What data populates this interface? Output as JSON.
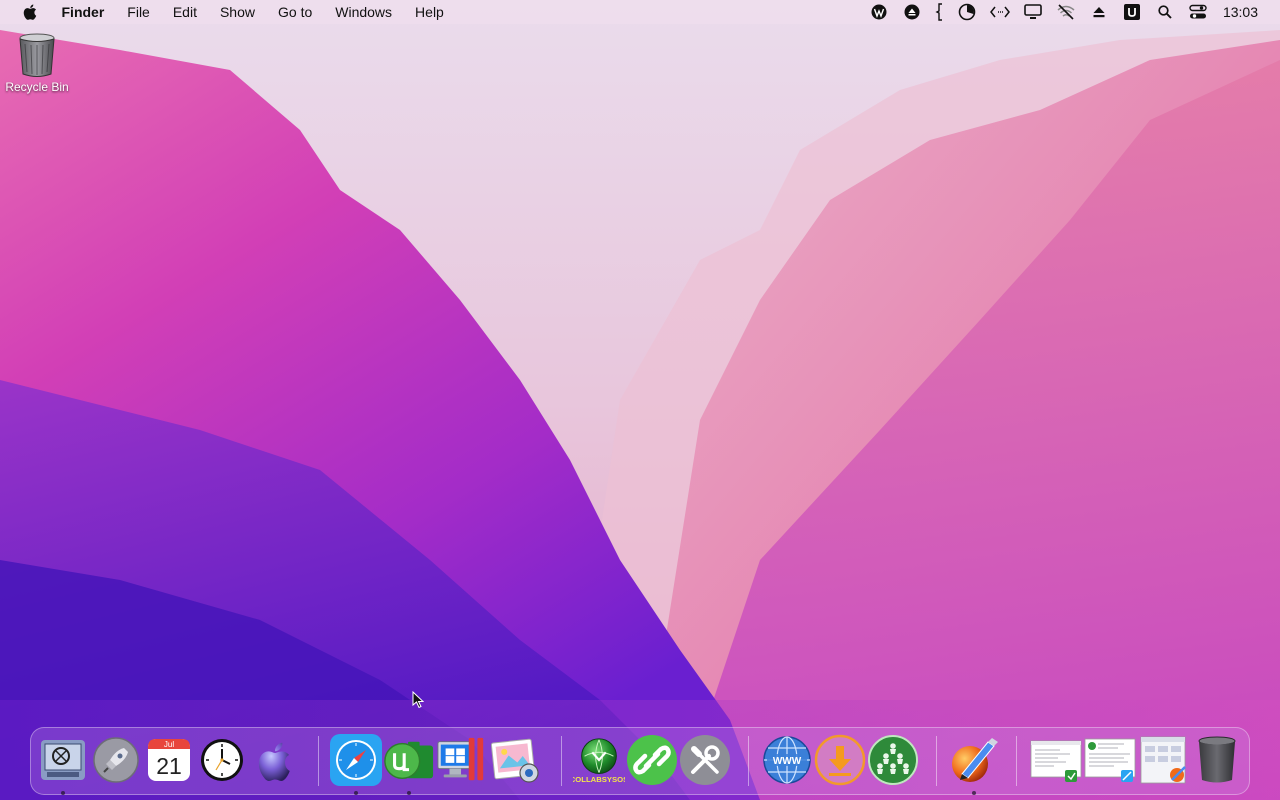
{
  "menubar": {
    "apple_icon": "apple-logo-icon",
    "items": [
      {
        "label": "Finder",
        "app": true
      },
      {
        "label": "File"
      },
      {
        "label": "Edit"
      },
      {
        "label": "Show"
      },
      {
        "label": "Go to"
      },
      {
        "label": "Windows"
      },
      {
        "label": "Help"
      }
    ],
    "tray_icons": [
      "wordpress-icon",
      "eject-circle-icon",
      "bracket-icon",
      "pie-timer-icon",
      "code-arrows-icon",
      "display-icon",
      "wifi-off-icon",
      "eject-icon",
      "u-app-icon",
      "search-icon",
      "control-center-icon"
    ],
    "clock": "13:03"
  },
  "desktop": {
    "recycle_bin_label": "Recycle Bin"
  },
  "dock": {
    "calendar": {
      "month": "Jul",
      "day": "21"
    },
    "collabsysos_label": "COLLABSYSOS",
    "www_label": "WWW",
    "apps": [
      "finder",
      "launchpad",
      "calendar",
      "clock",
      "apple-store",
      "safari",
      "utorrent",
      "parallels",
      "photo-viewer",
      "collabsysos",
      "link-app",
      "system-tools",
      "web-browser",
      "downloader",
      "network-app",
      "paint-brush",
      "window-thumb-1",
      "window-thumb-2",
      "window-thumb-3",
      "trash"
    ]
  },
  "colors": {
    "accent_pink": "#e040b0",
    "wallpaper_purple": "#6a1fd0"
  }
}
